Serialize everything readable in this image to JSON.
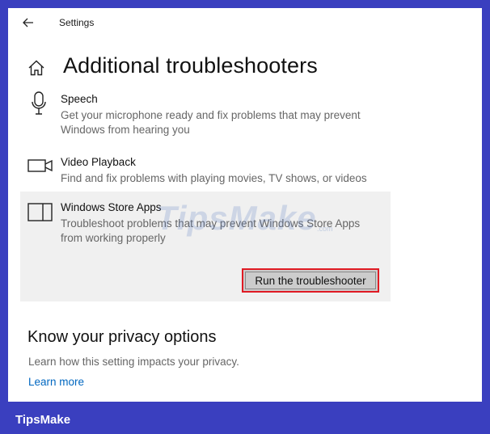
{
  "window": {
    "title": "Settings"
  },
  "page": {
    "title": "Additional troubleshooters"
  },
  "troubleshooters": [
    {
      "icon": "microphone-icon",
      "title": "Speech",
      "description_line1": "Get your microphone ready and fix problems that may prevent",
      "description_line2": "Windows from hearing you"
    },
    {
      "icon": "video-camera-icon",
      "title": "Video Playback",
      "description_line1": "Find and fix problems with playing movies, TV shows, or videos"
    },
    {
      "icon": "store-app-icon",
      "title": "Windows Store Apps",
      "description_line1": "Troubleshoot problems that may prevent Windows Store Apps",
      "description_line2": "from working properly",
      "button_label": "Run the troubleshooter"
    }
  ],
  "privacy": {
    "heading": "Know your privacy options",
    "description": "Learn how this setting impacts your privacy.",
    "link": "Learn more"
  },
  "watermark": {
    "text": "TipsMake",
    "suffix": ".com"
  },
  "footer": {
    "brand": "TipsMake"
  },
  "colors": {
    "background": "#3a3fbf",
    "link": "#0067c0",
    "button_border": "#e01b24",
    "selected_panel": "#f0f0f0"
  }
}
